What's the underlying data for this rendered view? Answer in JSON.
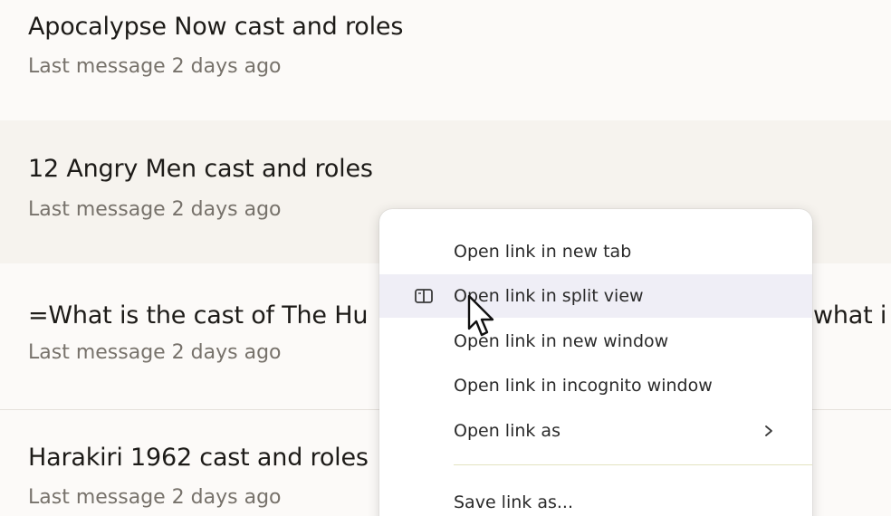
{
  "chats": [
    {
      "title": "Apocalypse Now cast and roles",
      "meta": "Last message 2 days ago"
    },
    {
      "title": "12 Angry Men cast and roles",
      "meta": "Last message 2 days ago"
    },
    {
      "title_left": "=What is the cast of The Hu",
      "title_right": "what i",
      "meta": "Last message 2 days ago"
    },
    {
      "title": "Harakiri 1962 cast and roles",
      "meta": "Last message 2 days ago"
    }
  ],
  "context_menu": {
    "items": [
      {
        "label": "Open link in new tab"
      },
      {
        "label": "Open link in split view",
        "icon": "split-view-icon"
      },
      {
        "label": "Open link in new window"
      },
      {
        "label": "Open link in incognito window"
      },
      {
        "label": "Open link as",
        "icon": "chevron-right-icon"
      },
      {
        "label": "Save link as..."
      }
    ]
  },
  "colors": {
    "background": "#fcfaf8",
    "hover_row": "#f6f3ee",
    "menu_hover": "#efeef6"
  }
}
